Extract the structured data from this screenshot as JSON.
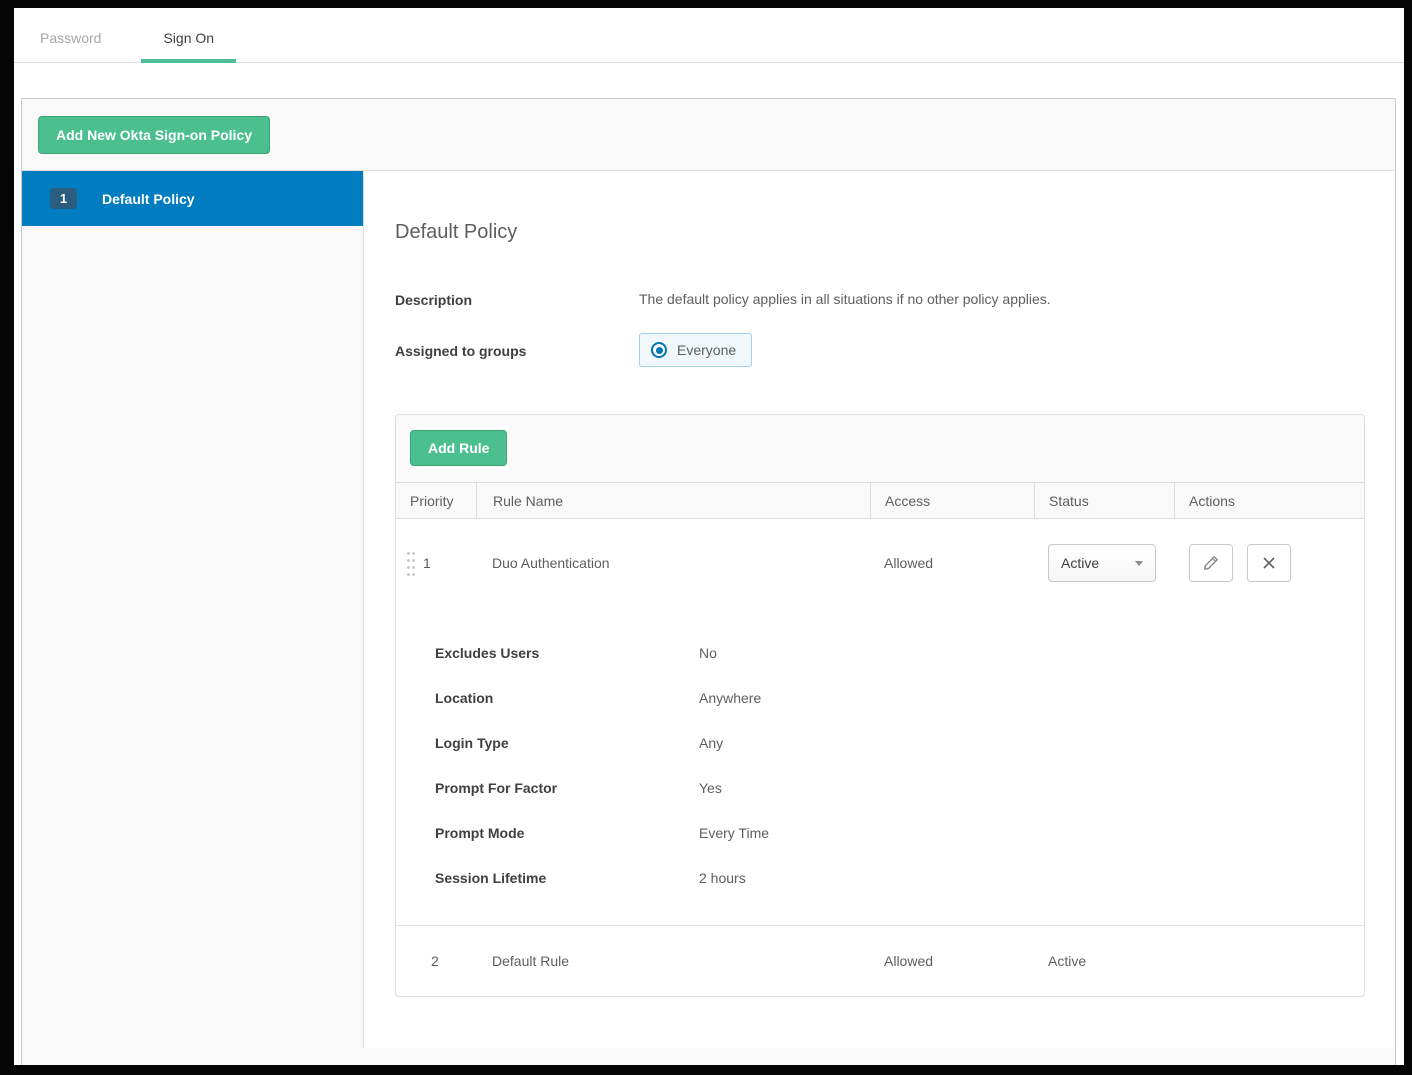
{
  "tabs": {
    "password": "Password",
    "sign_on": "Sign On"
  },
  "toolbar": {
    "add_policy_label": "Add New Okta Sign-on Policy"
  },
  "sidebar": {
    "selected_policy": {
      "priority": "1",
      "name": "Default Policy"
    }
  },
  "policy": {
    "title": "Default Policy",
    "description_label": "Description",
    "description_value": "The default policy applies in all situations if no other policy applies.",
    "assigned_label": "Assigned to groups",
    "assigned_value": "Everyone",
    "rules": {
      "add_rule_label": "Add Rule",
      "headers": {
        "priority": "Priority",
        "rule_name": "Rule Name",
        "access": "Access",
        "status": "Status",
        "actions": "Actions"
      },
      "rows": [
        {
          "priority": "1",
          "name": "Duo Authentication",
          "access": "Allowed",
          "status": "Active"
        },
        {
          "priority": "2",
          "name": "Default Rule",
          "access": "Allowed",
          "status": "Active"
        }
      ],
      "details": [
        {
          "label": "Excludes Users",
          "value": "No"
        },
        {
          "label": "Location",
          "value": "Anywhere"
        },
        {
          "label": "Login Type",
          "value": "Any"
        },
        {
          "label": "Prompt For Factor",
          "value": "Yes"
        },
        {
          "label": "Prompt Mode",
          "value": "Every Time"
        },
        {
          "label": "Session Lifetime",
          "value": "2 hours"
        }
      ]
    }
  },
  "colors": {
    "brand_blue": "#007dc1",
    "brand_green": "#4cbf8f",
    "tab_underline": "#4cbf95"
  }
}
